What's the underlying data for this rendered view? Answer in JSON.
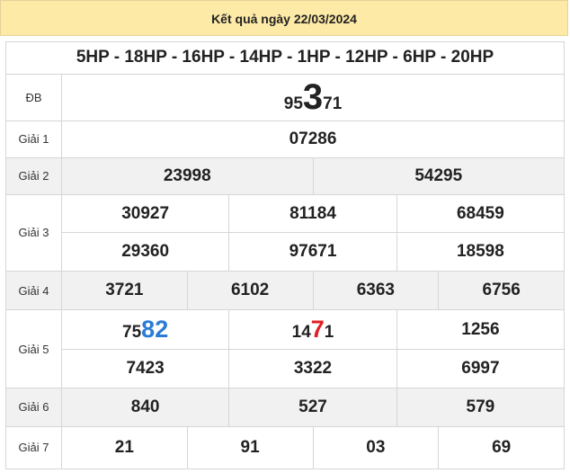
{
  "header": {
    "title": "Kết quả ngày 22/03/2024"
  },
  "codes": "5HP - 18HP - 16HP - 14HP - 1HP - 12HP - 6HP - 20HP",
  "labels": {
    "db": "ĐB",
    "g1": "Giải 1",
    "g2": "Giải 2",
    "g3": "Giải 3",
    "g4": "Giải 4",
    "g5": "Giải 5",
    "g6": "Giải 6",
    "g7": "Giải 7"
  },
  "db": {
    "pre": "95",
    "hi": "3",
    "post": "71"
  },
  "g1": [
    "07286"
  ],
  "g2": [
    "23998",
    "54295"
  ],
  "g3": [
    "30927",
    "81184",
    "68459",
    "29360",
    "97671",
    "18598"
  ],
  "g4": [
    "3721",
    "6102",
    "6363",
    "6756"
  ],
  "g5": {
    "n1": {
      "pre": "75",
      "hi": "82"
    },
    "n2": {
      "pre": "14",
      "hi": "7",
      "post": "1"
    },
    "n3": "1256",
    "n4": "7423",
    "n5": "3322",
    "n6": "6997"
  },
  "g6": [
    "840",
    "527",
    "579"
  ],
  "g7": [
    "21",
    "91",
    "03",
    "69"
  ],
  "colors": {
    "header_bg": "#fdeaa7",
    "red": "#e31e24",
    "blue": "#2a7bd6",
    "code_blue": "#1f3fa8",
    "row_gray": "#f1f1f1"
  }
}
